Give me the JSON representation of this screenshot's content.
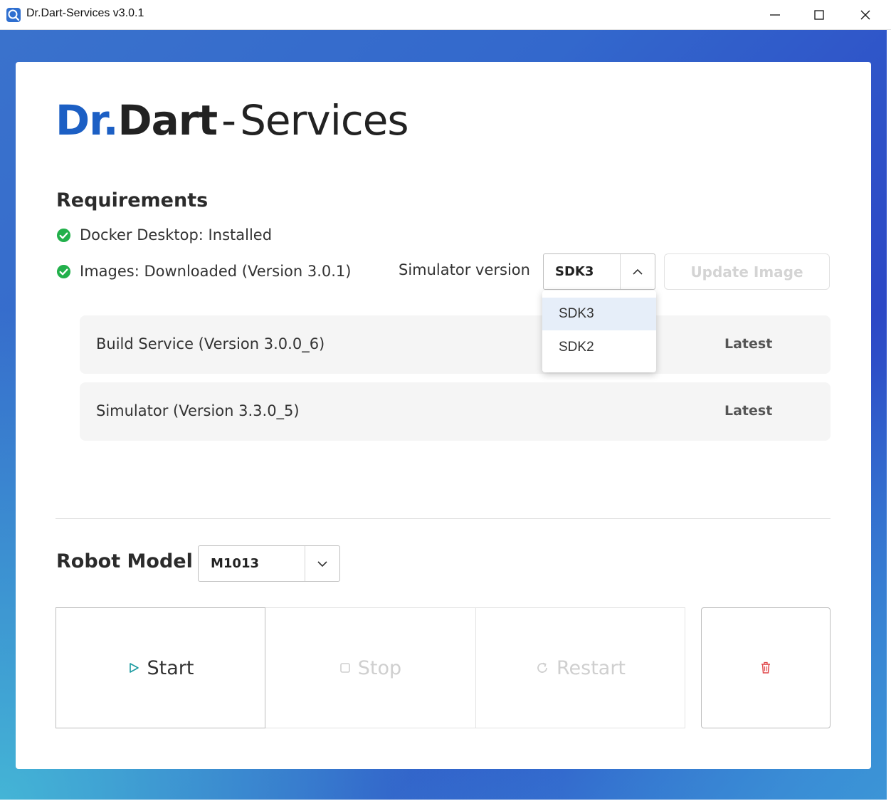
{
  "window": {
    "title": "Dr.Dart-Services v3.0.1",
    "icon": "app-logo-icon",
    "controls": [
      "minimize-icon",
      "maximize-icon",
      "close-icon"
    ]
  },
  "logo": {
    "part1": "Dr.",
    "part2": "Dart",
    "separator": "-",
    "part3": "Services"
  },
  "requirements": {
    "heading": "Requirements",
    "items": [
      {
        "label": "Docker Desktop: Installed",
        "icon": "check-circle-icon"
      },
      {
        "label": "Images: Downloaded (Version 3.0.1)",
        "icon": "check-circle-icon"
      }
    ],
    "simulator_version": {
      "label": "Simulator version",
      "selected": "SDK3",
      "options": [
        "SDK3",
        "SDK2"
      ],
      "open": true
    },
    "update_button": "Update Image",
    "services": [
      {
        "name": "Build Service (Version 3.0.0_6)",
        "status": "Latest"
      },
      {
        "name": "Simulator (Version 3.3.0_5)",
        "status": "Latest"
      }
    ]
  },
  "robot": {
    "heading": "Robot Model",
    "selected": "M1013"
  },
  "controls": {
    "start": "Start",
    "stop": "Stop",
    "restart": "Restart",
    "delete_icon": "trash-icon"
  },
  "colors": {
    "brand_blue": "#1c5fc4",
    "check_green": "#22b04b",
    "delete_red": "#e0484b"
  }
}
